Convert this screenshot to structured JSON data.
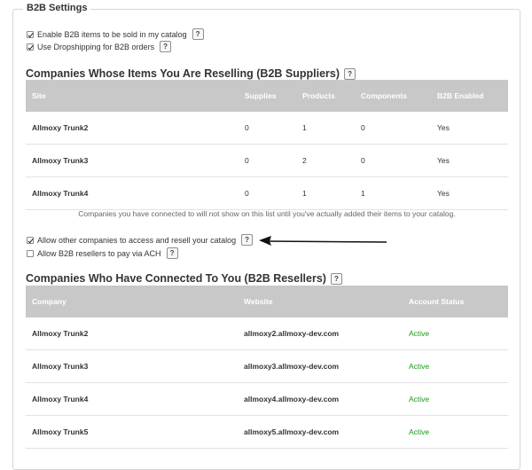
{
  "legend": "B2B Settings",
  "settings": {
    "enable_b2b": {
      "label": "Enable B2B items to be sold in my catalog",
      "checked": true
    },
    "dropshipping": {
      "label": "Use Dropshipping for B2B orders",
      "checked": true
    }
  },
  "help_label": "?",
  "suppliers": {
    "title": "Companies Whose Items You Are Reselling (B2B Suppliers)",
    "headers": [
      "Site",
      "Supplies",
      "Products",
      "Components",
      "B2B Enabled"
    ],
    "rows": [
      {
        "site": "Allmoxy Trunk2",
        "supplies": "0",
        "products": "1",
        "components": "0",
        "enabled": "Yes"
      },
      {
        "site": "Allmoxy Trunk3",
        "supplies": "0",
        "products": "2",
        "components": "0",
        "enabled": "Yes"
      },
      {
        "site": "Allmoxy Trunk4",
        "supplies": "0",
        "products": "1",
        "components": "1",
        "enabled": "Yes"
      }
    ],
    "note": "Companies you have connected to will not show on this list until you've actually added their items to your catalog."
  },
  "access": {
    "allow_resell": {
      "label": "Allow other companies to access and resell your catalog",
      "checked": true
    },
    "allow_ach": {
      "label": "Allow B2B resellers to pay via ACH",
      "checked": false
    }
  },
  "resellers": {
    "title": "Companies Who Have Connected To You (B2B Resellers)",
    "headers": [
      "Company",
      "Website",
      "Account Status"
    ],
    "rows": [
      {
        "company": "Allmoxy Trunk2",
        "website": "allmoxy2.allmoxy-dev.com",
        "status": "Active"
      },
      {
        "company": "Allmoxy Trunk3",
        "website": "allmoxy3.allmoxy-dev.com",
        "status": "Active"
      },
      {
        "company": "Allmoxy Trunk4",
        "website": "allmoxy4.allmoxy-dev.com",
        "status": "Active"
      },
      {
        "company": "Allmoxy Trunk5",
        "website": "allmoxy5.allmoxy-dev.com",
        "status": "Active"
      }
    ]
  },
  "colors": {
    "header_bg": "#c8c8c8",
    "active": "#1a9a1a"
  }
}
